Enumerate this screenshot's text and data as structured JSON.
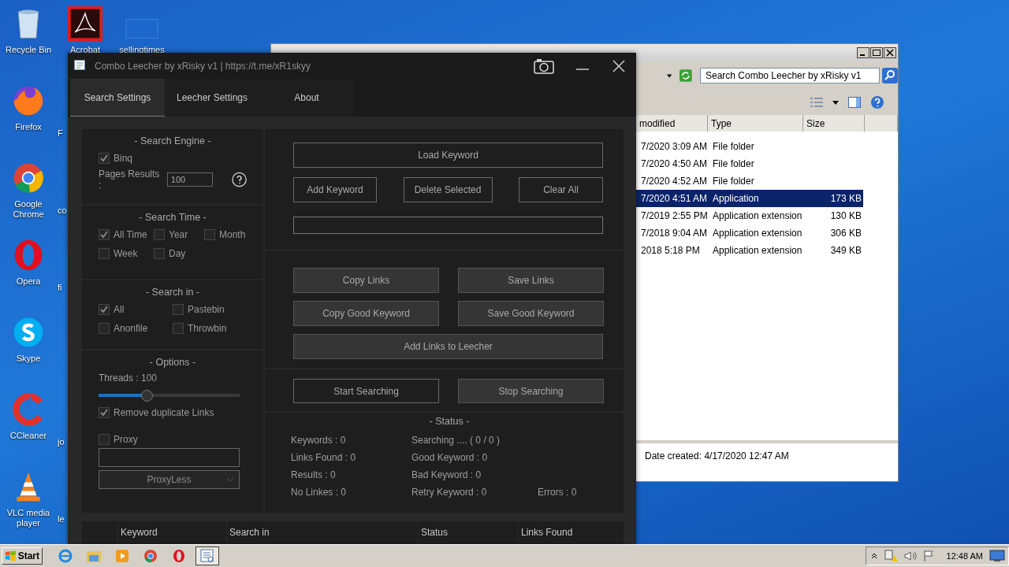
{
  "desktop": {
    "columns": [
      [
        {
          "label": "Recycle Bin",
          "kind": "bin"
        },
        {
          "label": "Firefox",
          "kind": "firefox"
        },
        {
          "label": "Google Chrome",
          "kind": "chrome"
        },
        {
          "label": "Opera",
          "kind": "opera"
        },
        {
          "label": "Skype",
          "kind": "skype"
        },
        {
          "label": "CCleaner",
          "kind": "ccleaner"
        },
        {
          "label": "VLC media player",
          "kind": "vlc"
        }
      ],
      [
        {
          "label": "Acrobat",
          "kind": "acrobat"
        },
        {
          "label": "F",
          "kind": "covered"
        },
        {
          "label": "co",
          "kind": "covered"
        },
        {
          "label": "fi",
          "kind": "covered"
        },
        {
          "kind": "gap"
        },
        {
          "label": "jo",
          "kind": "covered"
        },
        {
          "label": "le",
          "kind": "covered"
        }
      ],
      [
        {
          "label": "sellingtimes",
          "kind": "file"
        }
      ]
    ]
  },
  "explorer": {
    "search": {
      "placeholder": "Search Combo Leecher by xRisky v1"
    },
    "columns": [
      "modified",
      "Type",
      "Size"
    ],
    "rows": [
      {
        "modified": "7/2020 3:09 AM",
        "type": "File folder",
        "selected": false
      },
      {
        "modified": "7/2020 4:50 AM",
        "type": "File folder",
        "selected": false
      },
      {
        "modified": "7/2020 4:52 AM",
        "type": "File folder",
        "selected": false
      },
      {
        "modified": "7/2020 4:51 AM",
        "type": "Application",
        "size": "173 KB",
        "selected": true
      },
      {
        "modified": "7/2019 2:55 PM",
        "type": "Application extension",
        "size": "130 KB",
        "selected": false
      },
      {
        "modified": "7/2018 9:04 AM",
        "type": "Application extension",
        "size": "306 KB",
        "selected": false
      },
      {
        "modified": "2018 5:18 PM",
        "type": "Application extension",
        "size": "349 KB",
        "selected": false
      }
    ],
    "details": "Date created: 4/17/2020 12:47 AM"
  },
  "app": {
    "title": "Combo Leecher by xRisky v1 | https://t.me/xR1skyy",
    "tabs": [
      {
        "label": "Search Settings",
        "selected": true
      },
      {
        "label": "Leecher Settings",
        "selected": false
      },
      {
        "label": "About",
        "selected": false
      }
    ],
    "search_engine": {
      "heading": "- Search Engine -",
      "engine": {
        "label": "Binq",
        "checked": true
      },
      "pages_label": "Pages Results :",
      "pages_value": "100"
    },
    "search_time": {
      "heading": "- Search Time -",
      "options": [
        {
          "label": "All Time",
          "checked": true
        },
        {
          "label": "Year",
          "checked": false
        },
        {
          "label": "Month",
          "checked": false
        },
        {
          "label": "Week",
          "checked": false
        },
        {
          "label": "Day",
          "checked": false
        }
      ]
    },
    "search_in": {
      "heading": "- Search in -",
      "options": [
        {
          "label": "All",
          "checked": true
        },
        {
          "label": "Pastebin",
          "checked": false
        },
        {
          "label": "Anonfile",
          "checked": false
        },
        {
          "label": "Throwbin",
          "checked": false
        }
      ]
    },
    "options": {
      "heading": "- Options -",
      "threads_label": "Threads : 100",
      "threads": {
        "level": 0.34
      },
      "remove_duplicates": {
        "label": "Remove duplicate Links",
        "checked": true
      },
      "proxy": {
        "label": "Proxy",
        "checked": false
      },
      "proxy_type": "ProxyLess"
    },
    "keyword_buttons": [
      {
        "label": "Load Keyword",
        "kind": "outline"
      },
      {
        "label": "Add Keyword",
        "kind": "outline"
      },
      {
        "label": "Delete Selected",
        "kind": "outline"
      },
      {
        "label": "Clear All",
        "kind": "outline"
      }
    ],
    "link_buttons": [
      {
        "label": "Copy Links",
        "kind": "filled"
      },
      {
        "label": "Save Links",
        "kind": "filled"
      },
      {
        "label": "Copy Good Keyword",
        "kind": "filled"
      },
      {
        "label": "Save Good Keyword",
        "kind": "filled"
      },
      {
        "label": "Add Links to Leecher",
        "kind": "filled"
      }
    ],
    "progress": {
      "level": 0
    },
    "search_buttons": [
      {
        "label": "Start Searching",
        "kind": "outline"
      },
      {
        "label": "Stop Searching",
        "kind": "filled"
      }
    ],
    "status": {
      "heading": "-  Status  -",
      "left": [
        "Keywords : 0",
        "Links Found : 0",
        "Results : 0",
        "No Linkes : 0"
      ],
      "right": [
        "Searching .... ( 0 / 0 )",
        "Good Keyword : 0",
        "Bad Keyword : 0",
        "Retry Keyword : 0"
      ],
      "errors": "Errors : 0"
    },
    "table_columns": [
      "Keyword",
      "Search in",
      "Status",
      "Links Found"
    ]
  },
  "taskbar": {
    "start": "Start",
    "items": [
      {
        "kind": "ie",
        "selected": false
      },
      {
        "kind": "explorer",
        "selected": false
      },
      {
        "kind": "media",
        "selected": false
      },
      {
        "kind": "chrome",
        "selected": false
      },
      {
        "kind": "opera",
        "selected": false
      },
      {
        "kind": "app",
        "selected": true
      }
    ],
    "clock": "12:48 AM"
  }
}
